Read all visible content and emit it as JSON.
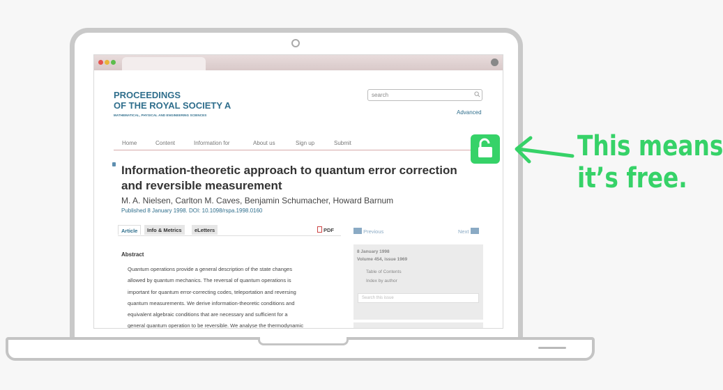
{
  "browser": {
    "window_controls": [
      "close",
      "minimize",
      "maximize"
    ]
  },
  "journal": {
    "title_line1": "PROCEEDINGS",
    "title_line2": "OF THE ROYAL SOCIETY A",
    "subtitle": "MATHEMATICAL, PHYSICAL AND ENGINEERING SCIENCES",
    "brand_color": "#2f6e8c"
  },
  "search": {
    "placeholder": "search",
    "advanced_label": "Advanced"
  },
  "nav": {
    "items": [
      "Home",
      "Content",
      "Information for",
      "About us",
      "Sign up",
      "Submit"
    ]
  },
  "article": {
    "title": "Information-theoretic approach to quantum error correction and reversible measurement",
    "authors": "M. A. Nielsen, Carlton M. Caves, Benjamin Schumacher, Howard Barnum",
    "published": "Published 8 January 1998. DOI: 10.1098/rspa.1998.0160",
    "tabs": [
      "Article",
      "Info & Metrics",
      "eLetters"
    ],
    "pdf_label": "PDF",
    "abstract_heading": "Abstract",
    "abstract_lines": [
      "Quantum operations provide a general description of the state changes",
      "allowed by quantum mechanics. The reversal of quantum operations is",
      "important for quantum error-correcting codes, teleportation and reversing",
      "quantum measurements. We derive information-theoretic conditions and",
      "equivalent algebraic conditions that are necessary and sufficient for a",
      "general quantum operation to be reversible. We analyse the thermodynamic"
    ]
  },
  "sidebar": {
    "previous_label": "Previous",
    "next_label": "Next",
    "date": "8 January 1998",
    "volume": "Volume 454, issue 1969",
    "toc": "Table of Contents",
    "index": "Index by author",
    "search_placeholder": "Search this issue"
  },
  "annotation": {
    "line1": "This means",
    "line2": "it’s free.",
    "color": "#36d268",
    "icon": "open-lock-icon"
  }
}
